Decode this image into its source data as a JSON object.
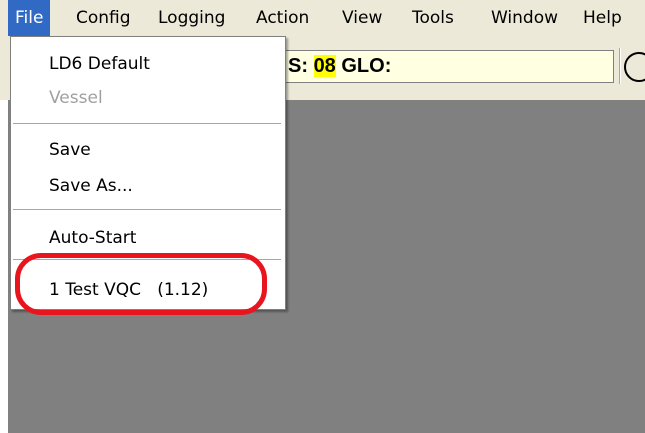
{
  "menubar": {
    "items": [
      {
        "label": "File"
      },
      {
        "label": "Config"
      },
      {
        "label": "Logging"
      },
      {
        "label": "Action"
      },
      {
        "label": "View"
      },
      {
        "label": "Tools"
      },
      {
        "label": "Window"
      },
      {
        "label": "Help"
      }
    ]
  },
  "toolbar": {
    "status_prefix": "S:",
    "status_value": "08",
    "status_suffix": "GLO:",
    "status_value_color": "#ffff00",
    "icon": "clock-icon"
  },
  "file_menu": {
    "items": [
      {
        "label": "LD6 Default"
      },
      {
        "label": "Vessel"
      },
      {
        "label": "Save"
      },
      {
        "label": "Save As..."
      },
      {
        "label": "Auto-Start"
      },
      {
        "label": "1 Test VQC   (1.12)"
      }
    ]
  },
  "colors": {
    "menu_selection": "#316ac5",
    "highlight_ring": "#e8141e",
    "workspace": "#808080"
  }
}
